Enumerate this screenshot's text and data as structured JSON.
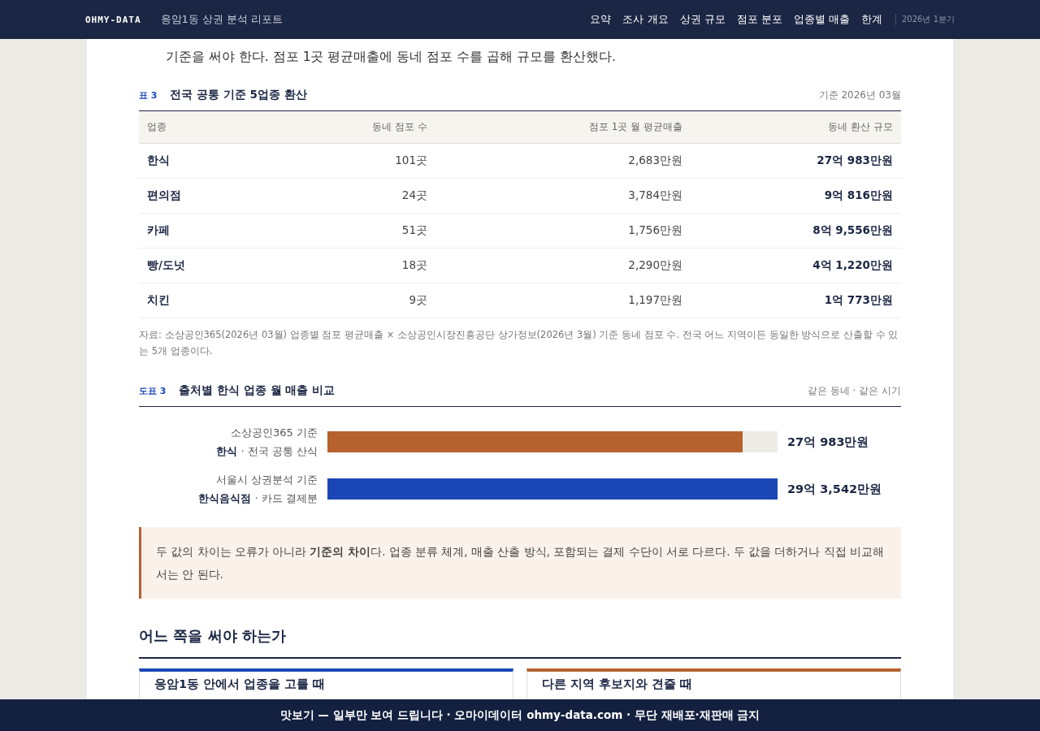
{
  "header": {
    "brand": "OHMY-DATA",
    "report_title": "응암1동 상권 분석 리포트",
    "nav": [
      {
        "label": "요약"
      },
      {
        "label": "조사 개요"
      },
      {
        "label": "상권 규모"
      },
      {
        "label": "점포 분포"
      },
      {
        "label": "업종별 매출"
      },
      {
        "label": "한계"
      }
    ],
    "period": "2026년 1분기"
  },
  "intro_text": "기준을 써야 한다. 점포 1곳 평균매출에 동네 점포 수를 곱해 규모를 환산했다.",
  "table": {
    "label": "표 3",
    "title": "전국 공통 기준 5업종 환산",
    "meta": "기준 2026년 03월",
    "columns": [
      "업종",
      "동네 점포 수",
      "점포 1곳 월 평균매출",
      "동네 환산 규모"
    ],
    "rows": [
      [
        "한식",
        "101곳",
        "2,683만원",
        "27억 983만원"
      ],
      [
        "편의점",
        "24곳",
        "3,784만원",
        "9억 816만원"
      ],
      [
        "카페",
        "51곳",
        "1,756만원",
        "8억 9,556만원"
      ],
      [
        "빵/도넛",
        "18곳",
        "2,290만원",
        "4억 1,220만원"
      ],
      [
        "치킨",
        "9곳",
        "1,197만원",
        "1억 773만원"
      ]
    ],
    "note": "자료: 소상공인365(2026년 03월) 업종별 점포 평균매출 × 소상공인시장진흥공단 상가정보(2026년 3월) 기준 동네 점포 수. 전국 어느 지역이든 동일한 방식으로 산출할 수 있는 5개 업종이다."
  },
  "figure": {
    "label": "도표 3",
    "title": "출처별 한식 업종 월 매출 비교",
    "meta": "같은 동네 · 같은 시기",
    "bars": [
      {
        "source": "소상공인365 기준",
        "category": "**한식** · 전국 공통 산식",
        "level": 0.923,
        "color": "#b5622e",
        "value": "27억 983만원"
      },
      {
        "source": "서울시 상권분석 기준",
        "category": "**한식음식점** · 카드 결제분",
        "level": 1.0,
        "color": "#1b46b5",
        "value": "29억 3,542만원"
      }
    ]
  },
  "callout": "두 값의 차이는 오류가 아니라 **기준의 차이**다. 업종 분류 체계, 매출 산출 방식, 포함되는 결제 수단이 서로 다르다. 두 값을 더하거나 직접 비교해서는 안 된다.",
  "section_heading": "어느 쪽을 써야 하는가",
  "cards": [
    {
      "title": "응암1동 안에서 업종을 고를 때",
      "color": "#1b46b5"
    },
    {
      "title": "다른 지역 후보지와 견줄 때",
      "color": "#b5622e"
    }
  ],
  "footer_banner": "맛보기 — 일부만 보여 드립니다 · 오마이데이터 ohmy-data.com · 무단 재배포·재판매 금지"
}
